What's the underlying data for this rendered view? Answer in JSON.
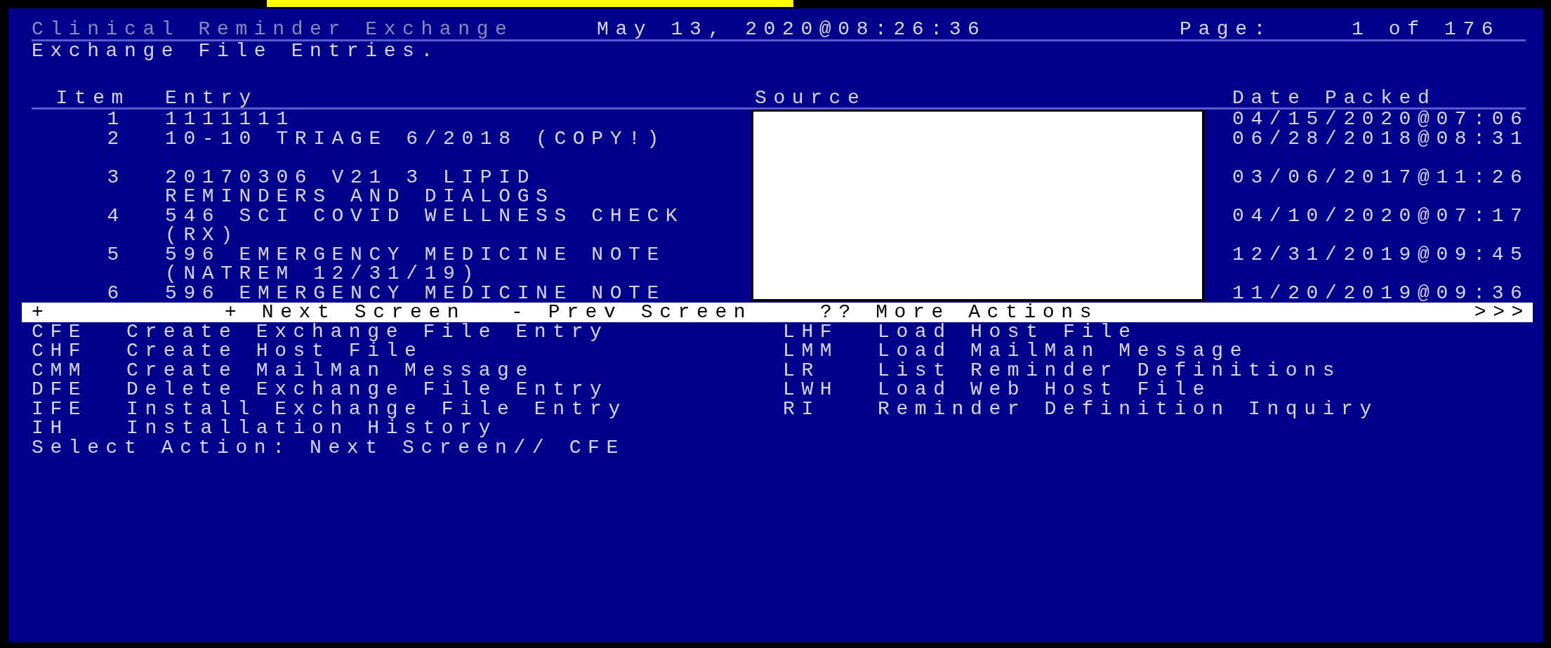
{
  "header": {
    "title": "Clinical Reminder Exchange",
    "timestamp": "May 13, 2020@08:26:36",
    "page_label": "Page:",
    "page_value": "1 of 176"
  },
  "subtitle": "Exchange File Entries.",
  "table": {
    "columns": [
      "Item",
      "Entry",
      "Source",
      "Date Packed"
    ],
    "rows": [
      {
        "item": "1",
        "entry": [
          "1111111"
        ],
        "date": "04/15/2020@07:06"
      },
      {
        "item": "2",
        "entry": [
          "10-10 TRIAGE 6/2018 (COPY!)"
        ],
        "date": "06/28/2018@08:31"
      },
      {
        "item": "3",
        "entry": [
          "20170306 V21 3 LIPID",
          "REMINDERS AND DIALOGS"
        ],
        "date": "03/06/2017@11:26"
      },
      {
        "item": "4",
        "entry": [
          "546 SCI COVID WELLNESS CHECK",
          "(RX)"
        ],
        "date": "04/10/2020@07:17"
      },
      {
        "item": "5",
        "entry": [
          "596 EMERGENCY MEDICINE NOTE",
          "(NATREM 12/31/19)"
        ],
        "date": "12/31/2019@09:45"
      },
      {
        "item": "6",
        "entry": [
          "596 EMERGENCY MEDICINE NOTE"
        ],
        "date": "11/20/2019@09:36"
      }
    ]
  },
  "action_bar": {
    "marker": "+",
    "next": "+ Next Screen",
    "prev": "- Prev Screen",
    "more": "?? More Actions",
    "arrows": ">>>"
  },
  "actions_left": [
    {
      "code": "CFE",
      "label": "Create Exchange File Entry"
    },
    {
      "code": "CHF",
      "label": "Create Host File"
    },
    {
      "code": "CMM",
      "label": "Create MailMan Message"
    },
    {
      "code": "DFE",
      "label": "Delete Exchange File Entry"
    },
    {
      "code": "IFE",
      "label": "Install Exchange File Entry"
    },
    {
      "code": "IH",
      "label": "Installation History"
    }
  ],
  "actions_right": [
    {
      "code": "LHF",
      "label": "Load Host File"
    },
    {
      "code": "LMM",
      "label": "Load MailMan Message"
    },
    {
      "code": "LR",
      "label": "List Reminder Definitions"
    },
    {
      "code": "LWH",
      "label": "Load Web Host File"
    },
    {
      "code": "RI",
      "label": "Reminder Definition Inquiry"
    }
  ],
  "prompt": "Select Action: Next Screen// CFE"
}
